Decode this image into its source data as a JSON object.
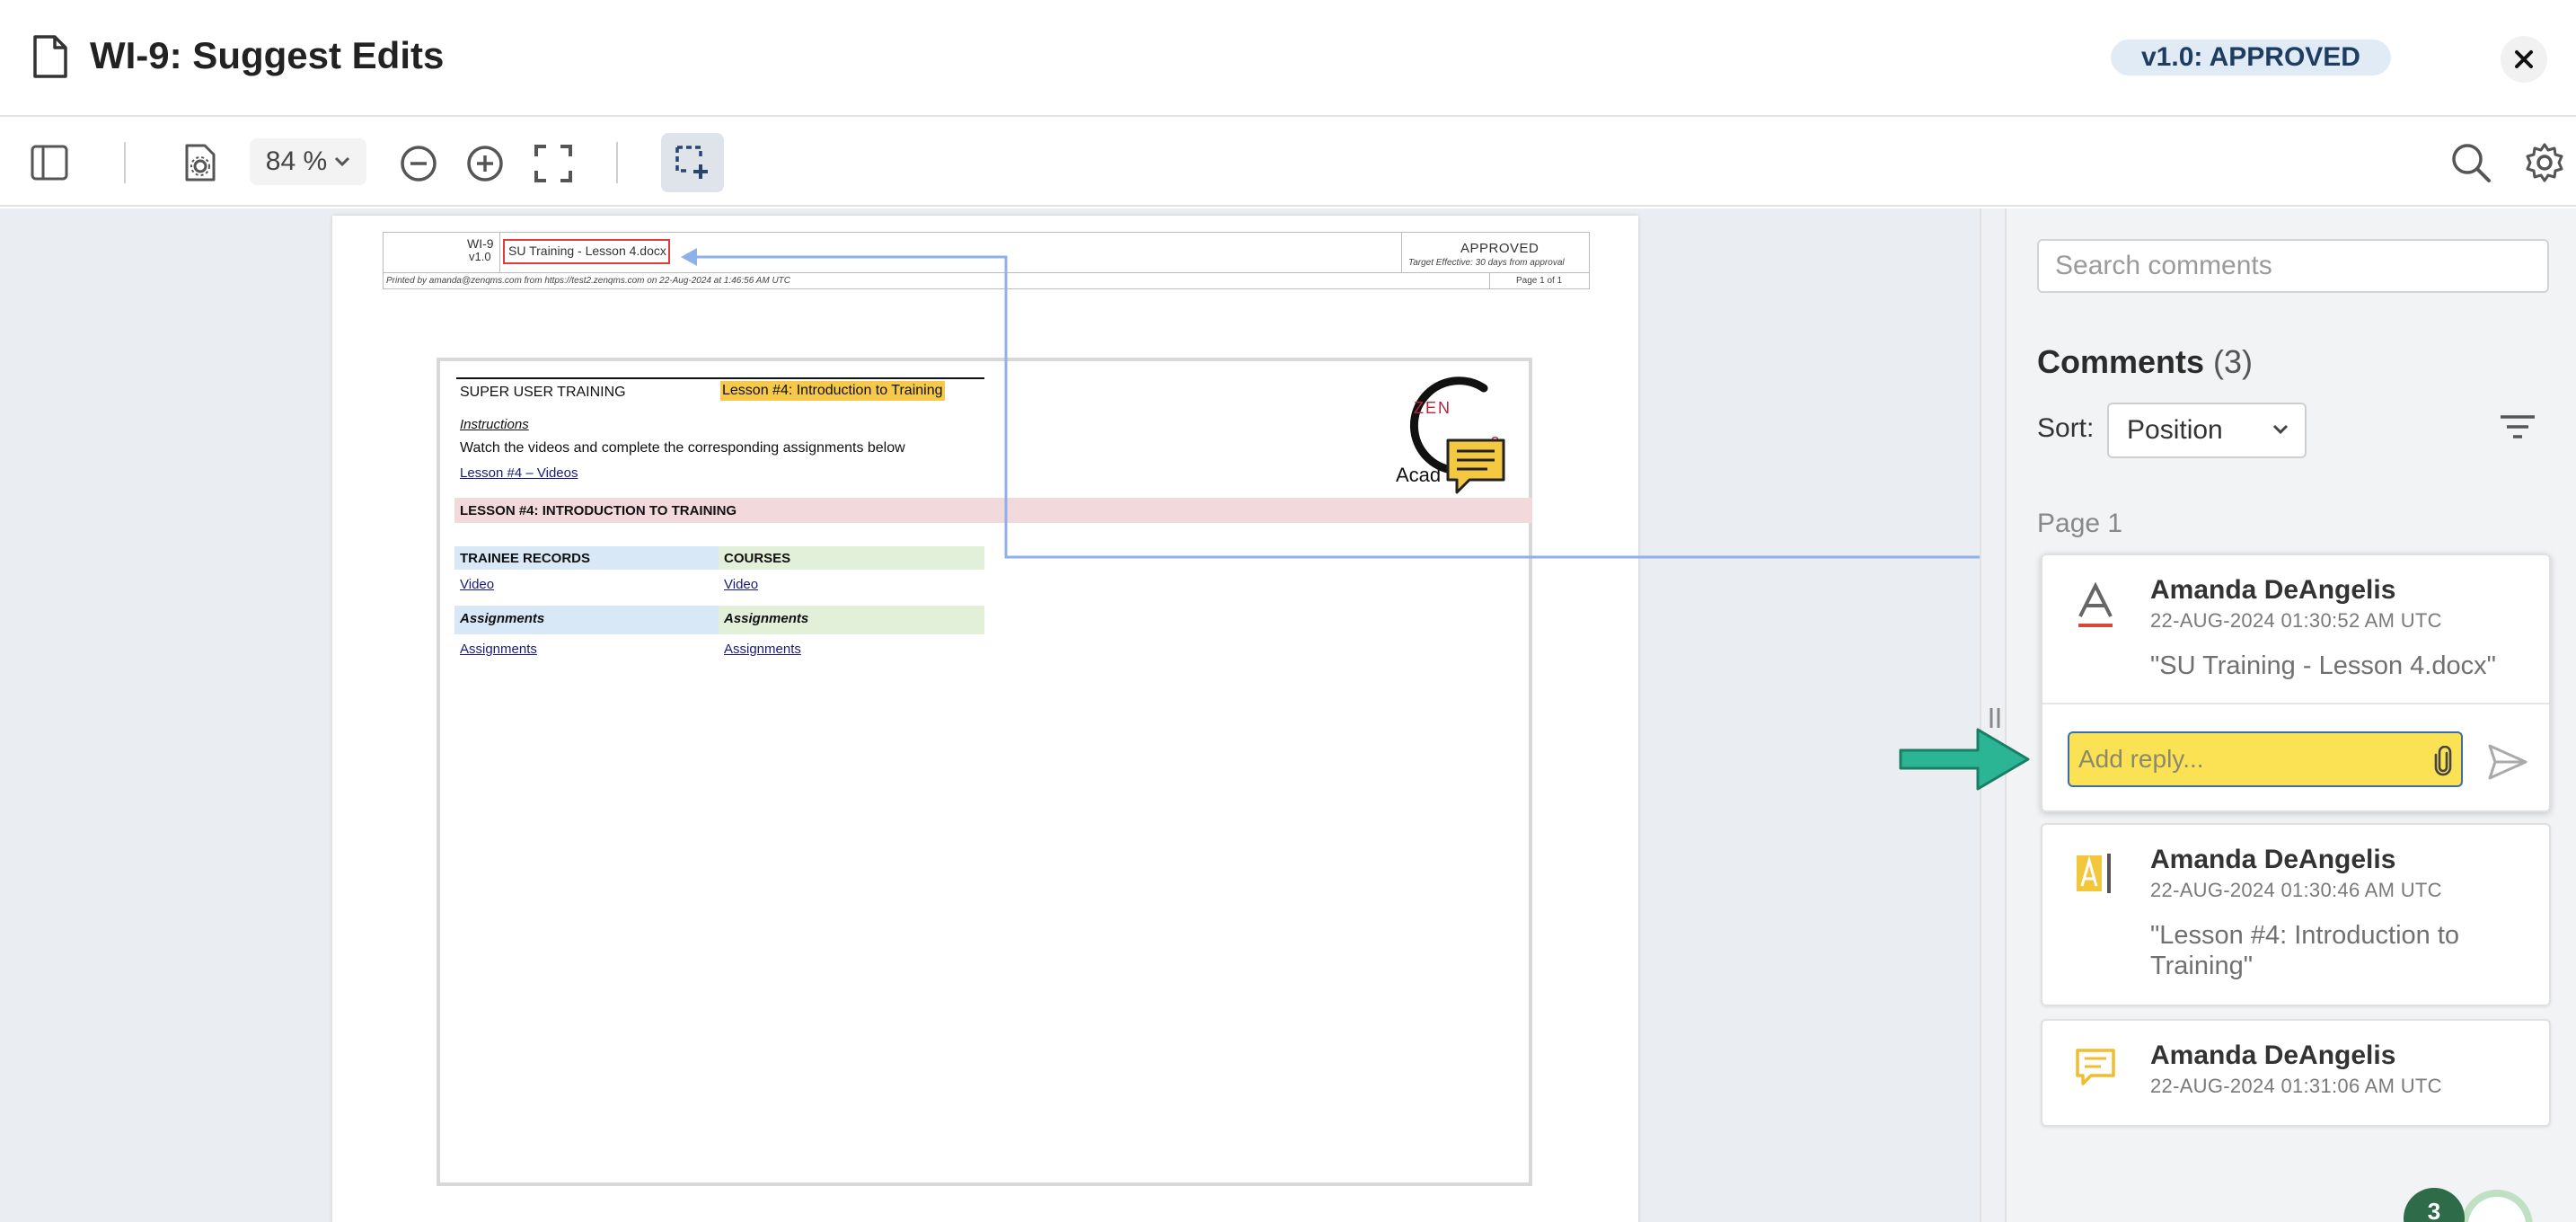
{
  "header": {
    "title": "WI-9: Suggest Edits",
    "status_badge": "v1.0: APPROVED"
  },
  "toolbar": {
    "zoom_value": "84 %"
  },
  "document": {
    "header": {
      "doc_id": "WI-9",
      "version": "v1.0",
      "filename": "SU Training - Lesson 4.docx",
      "status": "APPROVED",
      "effective": "Target Effective: 30 days from approval",
      "printed_by": "Printed by amanda@zenqms.com from https://test2.zenqms.com on 22-Aug-2024 at 1:46:56 AM UTC",
      "page_of": "Page 1 of 1"
    },
    "body": {
      "program": "SUPER USER TRAINING",
      "lesson_title": "Lesson #4: Introduction to Training",
      "instructions_heading": "Instructions",
      "instructions_text": "Watch the videos and complete the corresponding assignments below",
      "videos_link": "Lesson #4 – Videos",
      "section_heading": "LESSON #4: INTRODUCTION TO TRAINING",
      "col1_heading": "TRAINEE RECORDS",
      "col2_heading": "COURSES",
      "col1_video": "Video",
      "col2_video": "Video",
      "col1_assign_heading": "Assignments",
      "col2_assign_heading": "Assignments",
      "col1_assign_link": "Assignments",
      "col2_assign_link": "Assignments",
      "logo_top": "ZEN",
      "logo_bottom": "Acad",
      "logo_right": "s"
    }
  },
  "panel": {
    "search_placeholder": "Search comments",
    "comments_label": "Comments",
    "comments_count": "(3)",
    "sort_label": "Sort:",
    "sort_value": "Position",
    "page_label": "Page 1",
    "comments": [
      {
        "author": "Amanda DeAngelis",
        "date": "22-AUG-2024 01:30:52 AM UTC",
        "quote": "\"SU Training - Lesson 4.docx\"",
        "icon": "text-strikethrough-icon"
      },
      {
        "author": "Amanda DeAngelis",
        "date": "22-AUG-2024 01:30:46 AM UTC",
        "quote": "\"Lesson #4: Introduction to Training\"",
        "icon": "text-highlight-icon"
      },
      {
        "author": "Amanda DeAngelis",
        "date": "22-AUG-2024 01:31:06 AM UTC",
        "icon": "note-comment-icon"
      }
    ],
    "reply_placeholder": "Add reply..."
  },
  "floating_badge": "3",
  "colors": {
    "accent": "#3c6ea8",
    "highlight": "#fbe255",
    "badge_bg": "#e1ebf6",
    "arrow": "#2bb594"
  }
}
